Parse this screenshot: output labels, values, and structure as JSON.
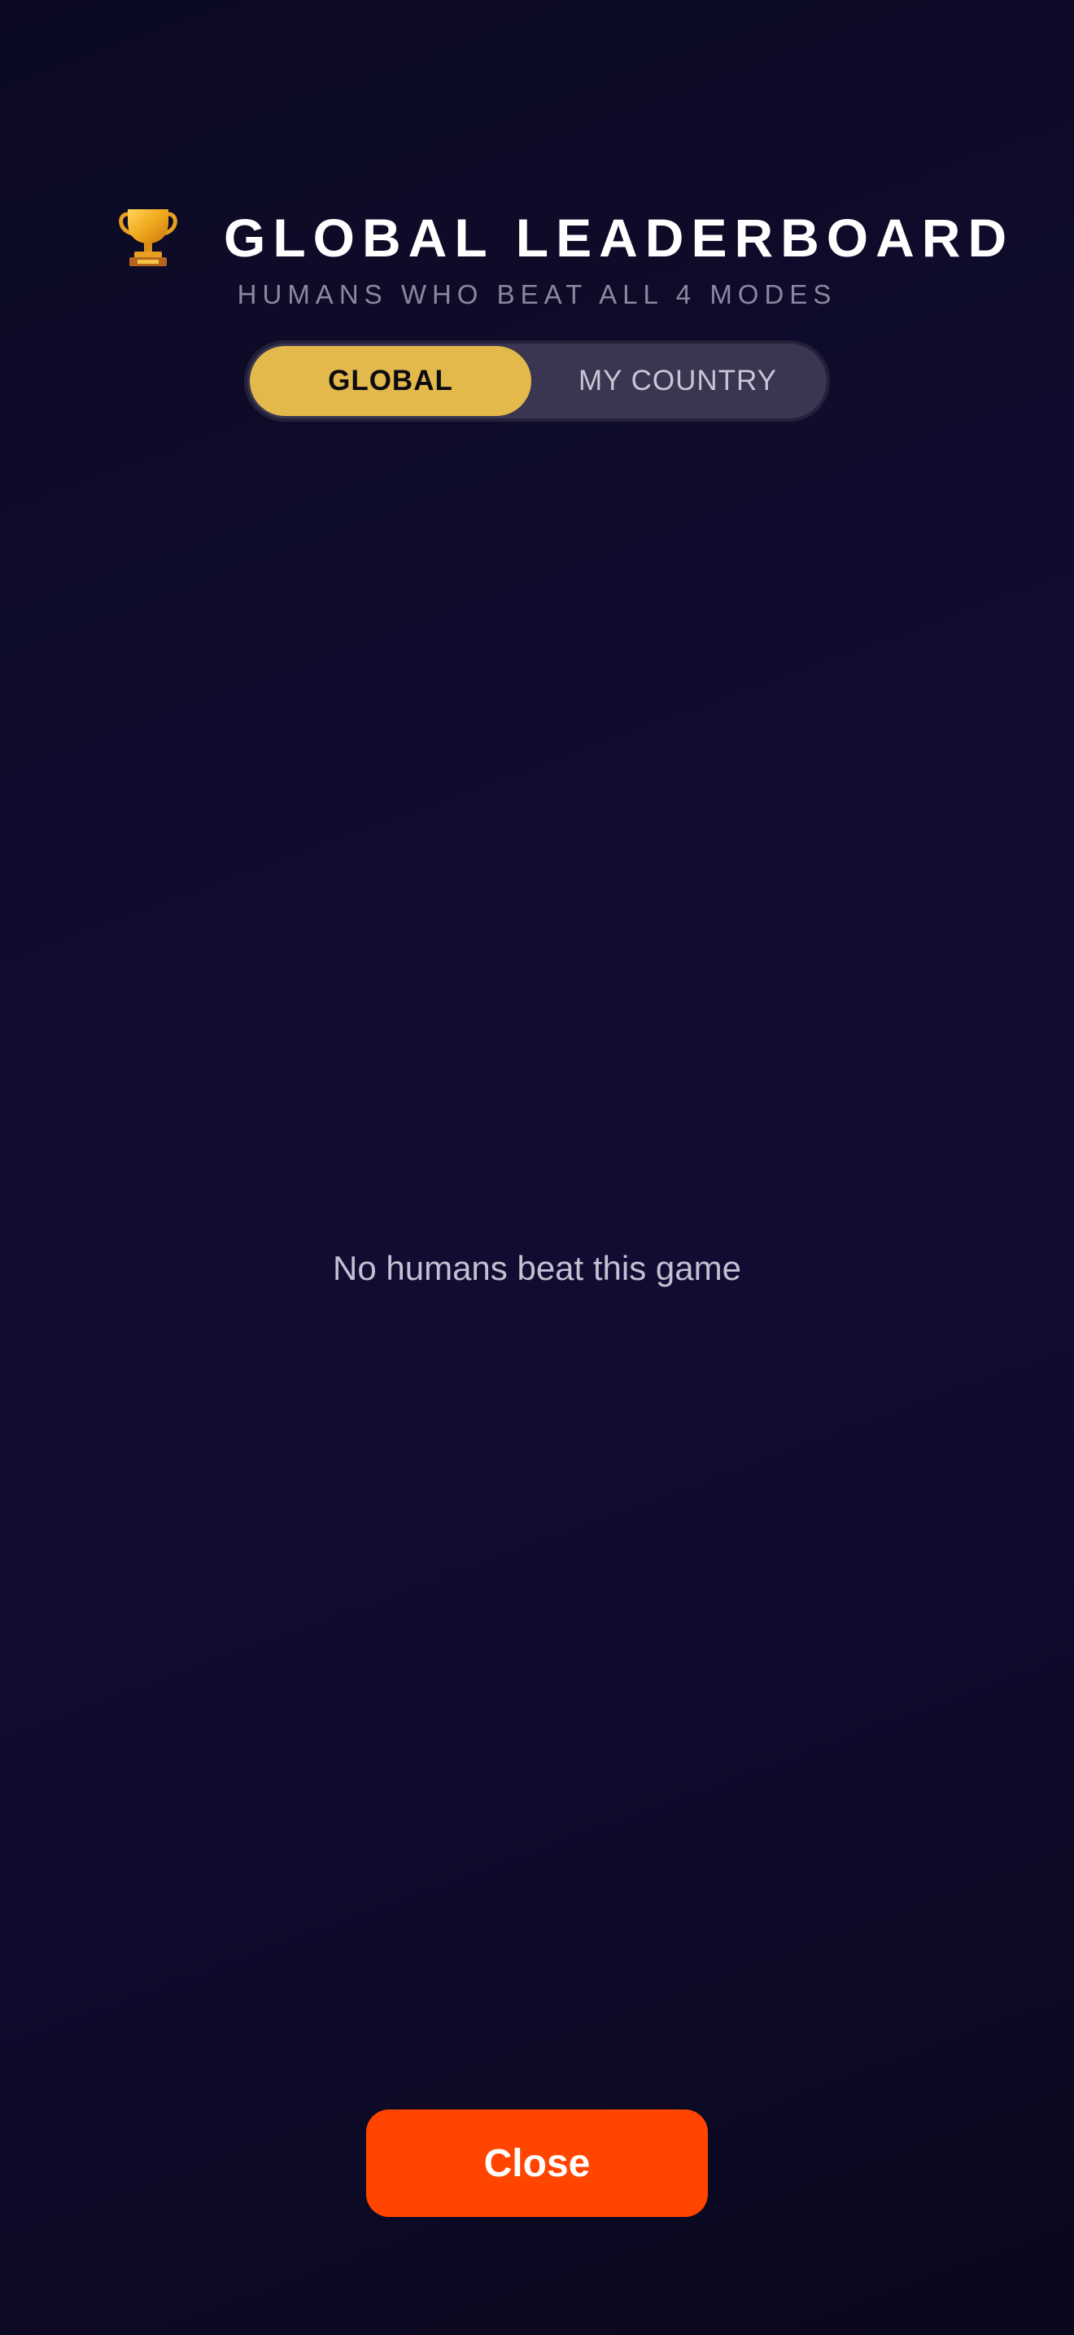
{
  "header": {
    "icon": "trophy-icon",
    "title": "GLOBAL LEADERBOARD",
    "subtitle": "HUMANS WHO BEAT ALL 4 MODES"
  },
  "tabs": {
    "selected": "GLOBAL",
    "items": [
      {
        "label": "GLOBAL",
        "active": true
      },
      {
        "label": "MY COUNTRY",
        "active": false
      }
    ]
  },
  "leaderboard": {
    "empty_message": "No humans beat this game"
  },
  "footer": {
    "close_label": "Close"
  },
  "colors": {
    "background": "#120d33",
    "accent_gold": "#e2b94a",
    "close_button": "#ff4500",
    "segment_bg": "#3a3550"
  }
}
